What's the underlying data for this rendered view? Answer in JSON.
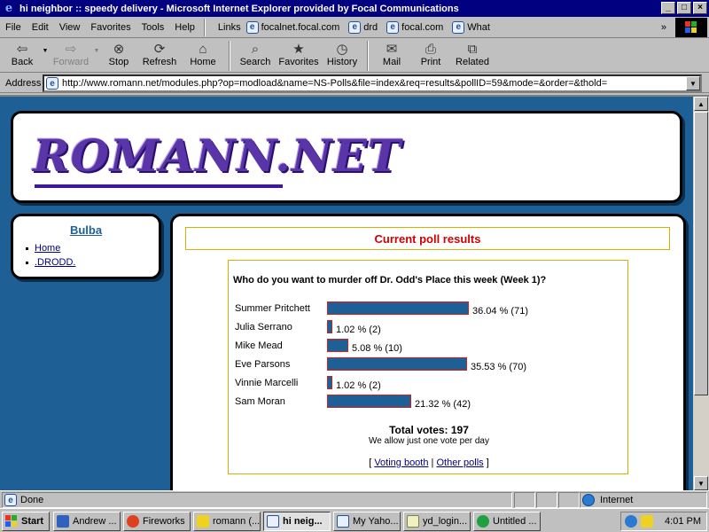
{
  "window": {
    "title": "hi neighbor :: speedy delivery - Microsoft Internet Explorer provided by Focal Communications",
    "buttons": [
      "_",
      "□",
      "×"
    ]
  },
  "menubar": {
    "items": [
      "File",
      "Edit",
      "View",
      "Favorites",
      "Tools",
      "Help"
    ],
    "links_label": "Links",
    "links": [
      "focalnet.focal.com",
      "drd",
      "focal.com",
      "What"
    ]
  },
  "toolbar": {
    "buttons": [
      {
        "label": "Back",
        "icon": "back-arrow-icon"
      },
      {
        "label": "Forward",
        "icon": "forward-arrow-icon"
      },
      {
        "label": "Stop",
        "icon": "stop-icon"
      },
      {
        "label": "Refresh",
        "icon": "refresh-icon"
      },
      {
        "label": "Home",
        "icon": "home-icon"
      },
      {
        "label": "Search",
        "icon": "search-icon"
      },
      {
        "label": "Favorites",
        "icon": "favorites-icon"
      },
      {
        "label": "History",
        "icon": "history-icon"
      },
      {
        "label": "Mail",
        "icon": "mail-icon"
      },
      {
        "label": "Print",
        "icon": "print-icon"
      },
      {
        "label": "Related",
        "icon": "related-icon"
      }
    ]
  },
  "address": {
    "label": "Address",
    "url": "http://www.romann.net/modules.php?op=modload&name=NS-Polls&file=index&req=results&pollID=59&mode=&order=&thold="
  },
  "page": {
    "logo_text": "ROMANN.NET",
    "sidebar": {
      "title": "Bulba",
      "links": [
        "Home",
        ".DRODD."
      ]
    },
    "results_title": "Current poll results",
    "poll": {
      "question": "Who do you want to murder off Dr. Odd's Place this week (Week 1)?",
      "options": [
        {
          "name": "Summer Pritchett",
          "percent": 36.04,
          "label": "36.04 % (71)"
        },
        {
          "name": "Julia Serrano",
          "percent": 1.02,
          "label": "1.02 % (2)"
        },
        {
          "name": "Mike Mead",
          "percent": 5.08,
          "label": "5.08 % (10)"
        },
        {
          "name": "Eve Parsons",
          "percent": 35.53,
          "label": "35.53 % (70)"
        },
        {
          "name": "Vinnie Marcelli",
          "percent": 1.02,
          "label": "1.02 % (2)"
        },
        {
          "name": "Sam Moran",
          "percent": 21.32,
          "label": "21.32 % (42)"
        }
      ],
      "total_votes": "Total votes: 197",
      "note": "We allow just one vote per day",
      "link_open": "[",
      "link_voting_booth": "Voting booth",
      "link_sep": "|",
      "link_other_polls": "Other polls",
      "link_close": "]"
    },
    "colors": {
      "background": "#1e5f96",
      "bar_fill": "#1e5f96",
      "bar_border": "#d02020",
      "results_title": "#d00000",
      "box_border": "#d4b000",
      "logo": "#5a35a8"
    }
  },
  "statusbar": {
    "status": "Done",
    "zone": "Internet"
  },
  "taskbar": {
    "start": "Start",
    "tasks": [
      {
        "label": "Andrew ...",
        "active": false
      },
      {
        "label": "Fireworks",
        "active": false
      },
      {
        "label": "romann (...",
        "active": false
      },
      {
        "label": "hi neig...",
        "active": true
      },
      {
        "label": "My Yaho...",
        "active": false
      },
      {
        "label": "yd_login...",
        "active": false
      },
      {
        "label": "Untitled ...",
        "active": false
      }
    ],
    "clock": "4:01 PM"
  }
}
